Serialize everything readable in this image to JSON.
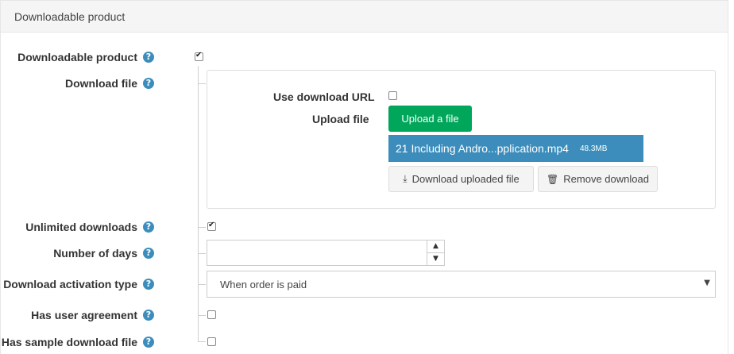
{
  "panel": {
    "title": "Downloadable product"
  },
  "fields": {
    "downloadable_product": {
      "label": "Downloadable product",
      "checked": true
    },
    "download_file": {
      "label": "Download file"
    },
    "unlimited_downloads": {
      "label": "Unlimited downloads",
      "checked": true
    },
    "number_of_days": {
      "label": "Number of days",
      "value": ""
    },
    "download_activation_type": {
      "label": "Download activation type",
      "selected": "When order is paid"
    },
    "has_user_agreement": {
      "label": "Has user agreement",
      "checked": false
    },
    "has_sample_download_file": {
      "label": "Has sample download file",
      "checked": false
    }
  },
  "download_box": {
    "use_download_url_label": "Use download URL",
    "use_download_url_checked": false,
    "upload_file_label": "Upload a file",
    "upload_file_field_label": "Upload file",
    "file_name": "21 Including Andro...pplication.mp4",
    "file_size": "48.3MB",
    "download_uploaded_label": "Download uploaded file",
    "remove_download_label": "Remove download"
  },
  "icons": {
    "help": "question-circle-icon",
    "download": "download-icon",
    "trash": "trash-icon"
  },
  "colors": {
    "accent": "#3c8dbc",
    "success": "#00a65a"
  }
}
